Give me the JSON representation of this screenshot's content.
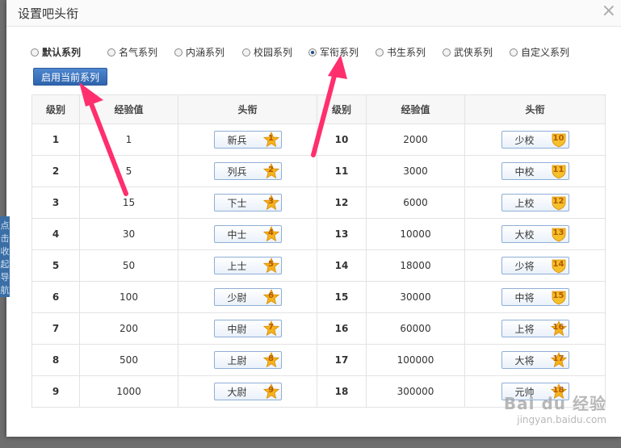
{
  "dialog": {
    "title": "设置吧头衔",
    "close_glyph": "×"
  },
  "side_tab": {
    "label": "点击收起导航"
  },
  "series_options": [
    {
      "label": "默认系列",
      "checked": false,
      "bold": true
    },
    {
      "label": "名气系列",
      "checked": false,
      "bold": false
    },
    {
      "label": "内涵系列",
      "checked": false,
      "bold": false
    },
    {
      "label": "校园系列",
      "checked": false,
      "bold": false
    },
    {
      "label": "军衔系列",
      "checked": true,
      "bold": false
    },
    {
      "label": "书生系列",
      "checked": false,
      "bold": false
    },
    {
      "label": "武侠系列",
      "checked": false,
      "bold": false
    },
    {
      "label": "自定义系列",
      "checked": false,
      "bold": false
    }
  ],
  "apply_button": {
    "label": "启用当前系列"
  },
  "table": {
    "headers": [
      "级别",
      "经验值",
      "头衔",
      "级别",
      "经验值",
      "头衔"
    ],
    "rows": [
      {
        "left": {
          "level": "1",
          "exp": "1",
          "title": "新兵"
        },
        "right": {
          "level": "10",
          "exp": "2000",
          "title": "少校"
        }
      },
      {
        "left": {
          "level": "2",
          "exp": "5",
          "title": "列兵"
        },
        "right": {
          "level": "11",
          "exp": "3000",
          "title": "中校"
        }
      },
      {
        "left": {
          "level": "3",
          "exp": "15",
          "title": "下士"
        },
        "right": {
          "level": "12",
          "exp": "6000",
          "title": "上校"
        }
      },
      {
        "left": {
          "level": "4",
          "exp": "30",
          "title": "中士"
        },
        "right": {
          "level": "13",
          "exp": "10000",
          "title": "大校"
        }
      },
      {
        "left": {
          "level": "5",
          "exp": "50",
          "title": "上士"
        },
        "right": {
          "level": "14",
          "exp": "18000",
          "title": "少将"
        }
      },
      {
        "left": {
          "level": "6",
          "exp": "100",
          "title": "少尉"
        },
        "right": {
          "level": "15",
          "exp": "30000",
          "title": "中将"
        }
      },
      {
        "left": {
          "level": "7",
          "exp": "200",
          "title": "中尉"
        },
        "right": {
          "level": "16",
          "exp": "60000",
          "title": "上将"
        }
      },
      {
        "left": {
          "level": "8",
          "exp": "500",
          "title": "上尉"
        },
        "right": {
          "level": "17",
          "exp": "100000",
          "title": "大将"
        }
      },
      {
        "left": {
          "level": "9",
          "exp": "1000",
          "title": "大尉"
        },
        "right": {
          "level": "18",
          "exp": "300000",
          "title": "元帅"
        }
      }
    ]
  },
  "watermark": {
    "line1": "Bai du 经验",
    "line2": "jingyan.baidu.com"
  },
  "colors": {
    "accent_blue": "#2e64ad",
    "arrow_pink": "#ff2f6e",
    "star_gold": "#f4b400"
  },
  "icons": {
    "level_badge": "star-level-icon",
    "shield_badge": "shield-level-icon"
  }
}
